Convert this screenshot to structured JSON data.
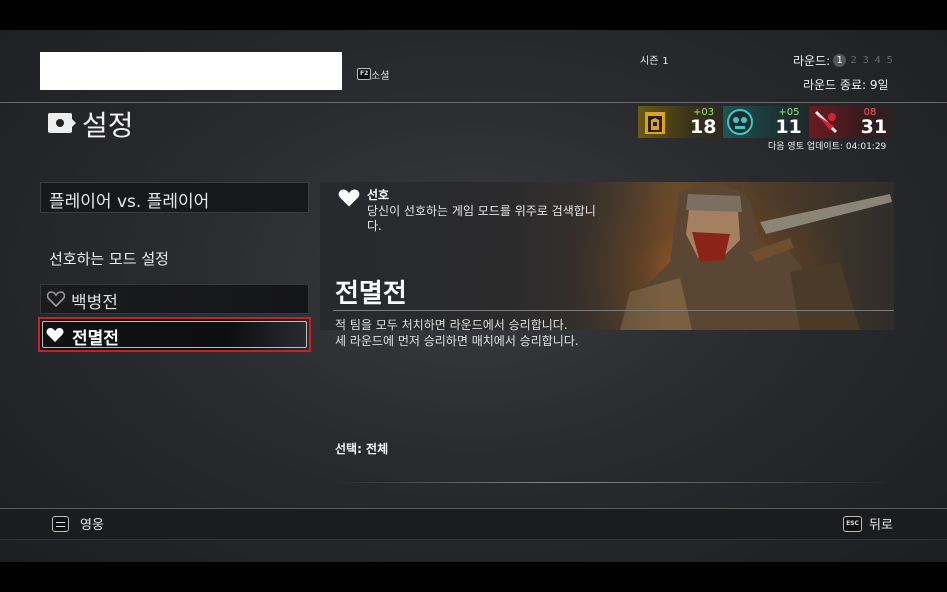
{
  "header": {
    "social_key": "F2",
    "social_label": "소셜",
    "season_label": "시즌",
    "season_value": "1",
    "round_label": "라운드:",
    "rounds": [
      "1",
      "2",
      "3",
      "4",
      "5"
    ],
    "active_round": "1",
    "round_end": "라운드 종료: 9일"
  },
  "page": {
    "title": "설정"
  },
  "scoreboard": {
    "factions": [
      {
        "name": "knights",
        "delta": "+03",
        "score": "18",
        "color": "#6b5a12"
      },
      {
        "name": "vikings",
        "delta": "+05",
        "score": "11",
        "color": "#1f5456"
      },
      {
        "name": "samurai",
        "delta": "08",
        "score": "31",
        "color": "#6b1a22"
      }
    ],
    "territory_update": "다음 영토 업데이트: 04:01:29"
  },
  "left_panel": {
    "mode_header": "플레이어 vs. 플레이어",
    "pref_title": "선호하는 모드 설정",
    "modes": [
      {
        "label": "백병전",
        "selected": false,
        "favorite": false
      },
      {
        "label": "전멸전",
        "selected": true,
        "favorite": true
      }
    ]
  },
  "detail": {
    "favorite_title": "선호",
    "favorite_desc": "당신이 선호하는 게임 모드를 위주로 검색합니다.",
    "mode_title": "전멸전",
    "desc_line1": "적 팀을 모두 처치하면 라운드에서 승리합니다.",
    "desc_line2": "세 라운드에 먼저 승리하면 매치에서 승리합니다.",
    "selection": "선택: 전체"
  },
  "footer": {
    "hero_label": "영웅",
    "back_key": "ESC",
    "back_label": "뒤로"
  },
  "colors": {
    "selection_border": "#cc1f24",
    "positive": "#9be07a",
    "negative": "#ff5a5a"
  }
}
